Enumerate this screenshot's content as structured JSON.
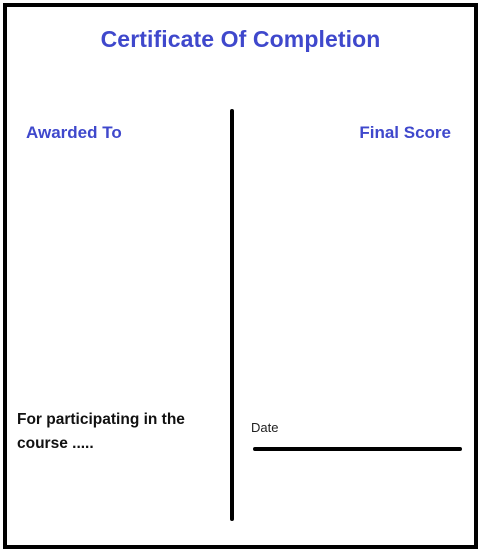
{
  "certificate": {
    "title": "Certificate Of Completion",
    "awarded_label": "Awarded To",
    "score_label": "Final Score",
    "participation_text": "For participating in the course .....",
    "date_label": "Date",
    "accent_color": "#3f48cc",
    "border_color": "#000000"
  }
}
